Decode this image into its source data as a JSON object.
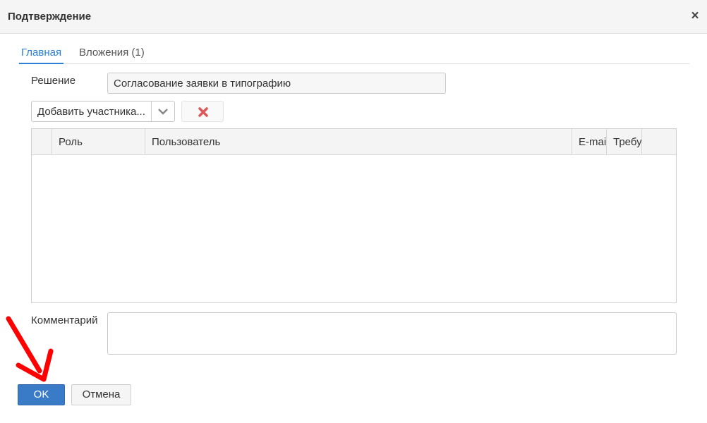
{
  "window": {
    "title": "Подтверждение",
    "close_glyph": "×"
  },
  "tabs": [
    {
      "label": "Главная",
      "active": true
    },
    {
      "label": "Вложения (1)",
      "active": false
    }
  ],
  "form": {
    "decision_label": "Решение",
    "decision_value": "Согласование заявки в типографию",
    "add_participant": "Добавить участника...",
    "comment_label": "Комментарий",
    "comment_value": ""
  },
  "grid": {
    "columns": [
      "",
      "Роль",
      "Пользователь",
      "E-mail",
      "Требуется",
      ""
    ],
    "rows": []
  },
  "buttons": {
    "ok": "OK",
    "cancel": "Отмена"
  },
  "colors": {
    "accent": "#2a7fd6",
    "primary_button": "#3a7bc8",
    "delete_icon": "#e05555",
    "annotation_arrow": "#ff0000"
  },
  "icons": {
    "close": "close-icon",
    "dropdown": "chevron-down-icon",
    "delete": "delete-icon",
    "annotation": "red-arrow"
  }
}
